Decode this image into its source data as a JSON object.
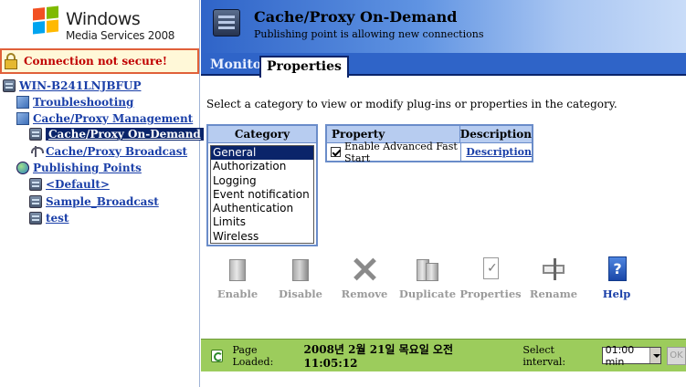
{
  "logo": {
    "brand": "Windows",
    "product": "Media Services 2008"
  },
  "connection": {
    "warning": "Connection not secure!"
  },
  "tree": {
    "server": "WIN-B241LNJBFUP",
    "items": [
      {
        "label": "Troubleshooting"
      },
      {
        "label": "Cache/Proxy Management"
      },
      {
        "label": "Cache/Proxy On-Demand"
      },
      {
        "label": "Cache/Proxy Broadcast"
      },
      {
        "label": "Publishing Points"
      },
      {
        "label": "<Default>"
      },
      {
        "label": "Sample_Broadcast"
      },
      {
        "label": "test"
      }
    ]
  },
  "header": {
    "title": "Cache/Proxy On-Demand",
    "subtitle": "Publishing point is allowing new connections"
  },
  "tabs": [
    {
      "label": "Monitor"
    },
    {
      "label": "Properties"
    }
  ],
  "instructions": "Select a category to view or modify plug-ins or properties in the category.",
  "category": {
    "header": "Category",
    "options": [
      "General",
      "Authorization",
      "Logging",
      "Event notification",
      "Authentication",
      "Limits",
      "Wireless"
    ],
    "selected": "General"
  },
  "properties_table": {
    "headers": [
      "Property",
      "Description"
    ],
    "rows": [
      {
        "property": "Enable Advanced Fast Start",
        "checked": true,
        "description": "Description"
      }
    ]
  },
  "toolbar": {
    "buttons": [
      {
        "label": "Enable",
        "icon": "enable-icon",
        "enabled": false
      },
      {
        "label": "Disable",
        "icon": "disable-icon",
        "enabled": false
      },
      {
        "label": "Remove",
        "icon": "remove-icon",
        "enabled": false
      },
      {
        "label": "Duplicate",
        "icon": "duplicate-icon",
        "enabled": false
      },
      {
        "label": "Properties",
        "icon": "properties-icon",
        "enabled": false
      },
      {
        "label": "Rename",
        "icon": "rename-icon",
        "enabled": false
      },
      {
        "label": "Help",
        "icon": "help-icon",
        "enabled": true
      }
    ]
  },
  "status": {
    "page_loaded_label": "Page Loaded:",
    "page_loaded_value": "2008년 2월 21일 목요일 오전 11:05:12",
    "interval_label": "Select interval:",
    "interval_value": "01:00 min",
    "ok_label": "OK"
  },
  "colors": {
    "header_blue": "#2f64c8",
    "status_green": "#9ccc5c",
    "link": "#1a3fa8",
    "warning": "#c00000"
  }
}
